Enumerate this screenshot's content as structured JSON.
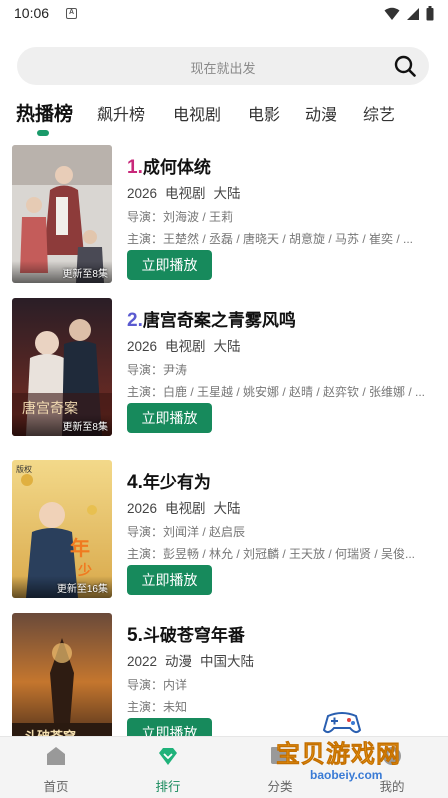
{
  "status_bar": {
    "time": "10:06",
    "notification_letter": "A"
  },
  "search": {
    "placeholder": "现在就出发"
  },
  "tabs": [
    {
      "label": "热播榜",
      "active": true
    },
    {
      "label": "飙升榜",
      "active": false
    },
    {
      "label": "电视剧",
      "active": false
    },
    {
      "label": "电影",
      "active": false
    },
    {
      "label": "动漫",
      "active": false
    },
    {
      "label": "综艺",
      "active": false
    }
  ],
  "items": [
    {
      "rank": "1.",
      "rank_color": "#c8287a",
      "title": "成何体统",
      "year": "2026",
      "genre": "电视剧",
      "region": "大陆",
      "director": "导演：刘海波 / 王莉",
      "cast": "主演：王楚然 / 丞磊 / 唐晓天 / 胡意旋 / 马苏 / 崔奕 / ...",
      "badge": "更新至8集",
      "play_label": "立即播放"
    },
    {
      "rank": "2.",
      "rank_color": "#5a5ad0",
      "title": "唐宫奇案之青雾风鸣",
      "year": "2026",
      "genre": "电视剧",
      "region": "大陆",
      "director": "导演：尹涛",
      "cast": "主演：白鹿 / 王星越 / 姚安娜 / 赵晴 / 赵弈钦 / 张维娜 / ...",
      "badge": "更新至8集",
      "play_label": "立即播放"
    },
    {
      "rank": "4.",
      "rank_color": "#111111",
      "title": "年少有为",
      "year": "2026",
      "genre": "电视剧",
      "region": "大陆",
      "director": "导演：刘闻洋 / 赵启辰",
      "cast": "主演：彭昱畅 / 林允 / 刘冠麟 / 王天放 / 何瑞贤 / 吴俊...",
      "badge": "更新至16集",
      "play_label": "立即播放"
    },
    {
      "rank": "5.",
      "rank_color": "#111111",
      "title": "斗破苍穹年番",
      "year": "2022",
      "genre": "动漫",
      "region": "中国大陆",
      "director": "导演：内详",
      "cast": "主演：未知",
      "badge": "",
      "play_label": "立即播放"
    }
  ],
  "bottom_nav": [
    {
      "label": "首页",
      "icon": "home-icon",
      "active": false
    },
    {
      "label": "排行",
      "icon": "ranking-icon",
      "active": true
    },
    {
      "label": "分类",
      "icon": "category-icon",
      "active": false
    },
    {
      "label": "我的",
      "icon": "profile-icon",
      "active": false
    }
  ],
  "watermark": {
    "text": "宝贝游戏网",
    "domain": "baobeiy.com"
  },
  "colors": {
    "accent": "#178a5c",
    "search_bg": "#efefef",
    "nav_bg": "#f4f4f4"
  }
}
